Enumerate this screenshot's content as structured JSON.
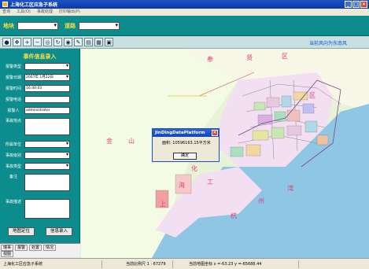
{
  "window": {
    "title": "上海化工区应急子系统"
  },
  "menu": [
    "查询",
    "工具(O)",
    "事故处理",
    "打印输出(P)"
  ],
  "selbar": {
    "region_label": "地块",
    "road_label": "道路"
  },
  "toolbar": {
    "tools": [
      "info-icon",
      "pan-icon",
      "zoom-in-icon",
      "zoom-out-icon",
      "zoom-rect-icon",
      "refresh-icon",
      "full-extent-icon",
      "measure-icon",
      "layer-icon",
      "table-icon",
      "print-icon"
    ],
    "wind": "当前风向为东南风"
  },
  "sidebar": {
    "title": "事件信息录入",
    "fields": [
      {
        "label": "报警类型",
        "value": "",
        "type": "dropdown"
      },
      {
        "label": "报警日期",
        "value": "2007年 1月22日",
        "type": "dropdown"
      },
      {
        "label": "报警时间",
        "value": "16:40:03",
        "type": "spin"
      },
      {
        "label": "报警电话",
        "value": "",
        "type": "text"
      },
      {
        "label": "报警人",
        "value": "administrator",
        "type": "text"
      },
      {
        "label": "事故地点",
        "value": "",
        "type": "textarea"
      },
      {
        "label": "所属单位",
        "value": "",
        "type": "dropdown"
      },
      {
        "label": "事故级别",
        "value": "",
        "type": "dropdown"
      },
      {
        "label": "事故类型",
        "value": "",
        "type": "dropdown"
      },
      {
        "label": "备注",
        "value": "",
        "type": "textarea"
      },
      {
        "label": "事故描述",
        "value": "",
        "type": "textarea"
      }
    ],
    "buttons": {
      "locate": "地图定位",
      "submit": "信息录入"
    },
    "tabs": [
      "瑞事",
      "报警",
      "处置",
      "情况",
      "视图"
    ]
  },
  "map": {
    "labels": [
      "奉",
      "贤",
      "区",
      "区",
      "金",
      "山",
      "化",
      "工",
      "杭",
      "湾",
      "上",
      "海",
      "州"
    ]
  },
  "dialog": {
    "title": "JinDingDataPlatform",
    "message": "面积: 10596163.15平方米",
    "ok": "确定"
  },
  "status": {
    "system": "上海化工区应急子系统",
    "scale": "当前比例尺 1 : 67279",
    "coords": "当前地图坐标 x =-63.23 y =-65688.44"
  },
  "colors": {
    "panel": "#0c8c8c",
    "accent": "#ffe040",
    "titlebar": "#0a3aa8"
  }
}
